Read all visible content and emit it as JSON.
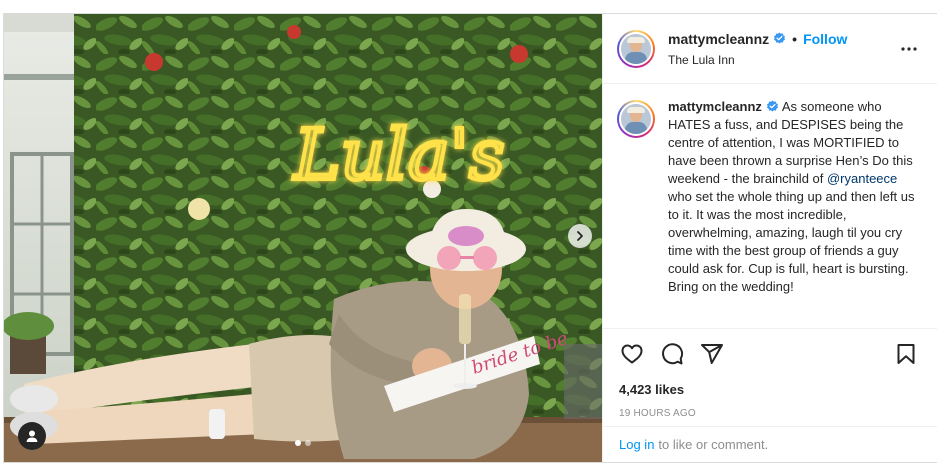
{
  "post": {
    "media": {
      "neon_sign": "Lula's",
      "sash_text": "bride to be",
      "carousel_dot_count": 2,
      "carousel_active_index": 0,
      "icons": {
        "next": "chevron-right-icon",
        "user_tags": "person-icon"
      }
    },
    "header": {
      "username": "mattymcleannz",
      "separator": "•",
      "follow_label": "Follow",
      "location": "The Lula Inn",
      "icons": {
        "verified": "verified-badge-icon",
        "more": "more-options-icon"
      }
    },
    "caption": {
      "username": "mattymcleannz",
      "text_before_mention": "As someone who HATES a fuss, and DESPISES being the centre of attention, I was MORTIFIED to have been thrown a surprise Hen’s Do this weekend - the brainchild of ",
      "mention": "@ryanteece",
      "text_after_mention": " who set the whole thing up and then left us to it. It was the most incredible, overwhelming, amazing, laugh til you cry time with the best group of friends a guy could ask for. Cup is full, heart is bursting. Bring on the wedding!"
    },
    "actions": {
      "icons": [
        "heart-icon",
        "comment-icon",
        "share-icon",
        "bookmark-icon"
      ]
    },
    "likes": "4,423 likes",
    "timestamp": "19 HOURS AGO",
    "login_prompt": {
      "link": "Log in",
      "text": "to like or comment."
    },
    "colors": {
      "link_blue": "#0095f6",
      "mention_blue": "#00376b",
      "muted_gray": "#8e8e8e",
      "border": "#dbdbdb",
      "neon_yellow": "#ffe14a"
    }
  }
}
